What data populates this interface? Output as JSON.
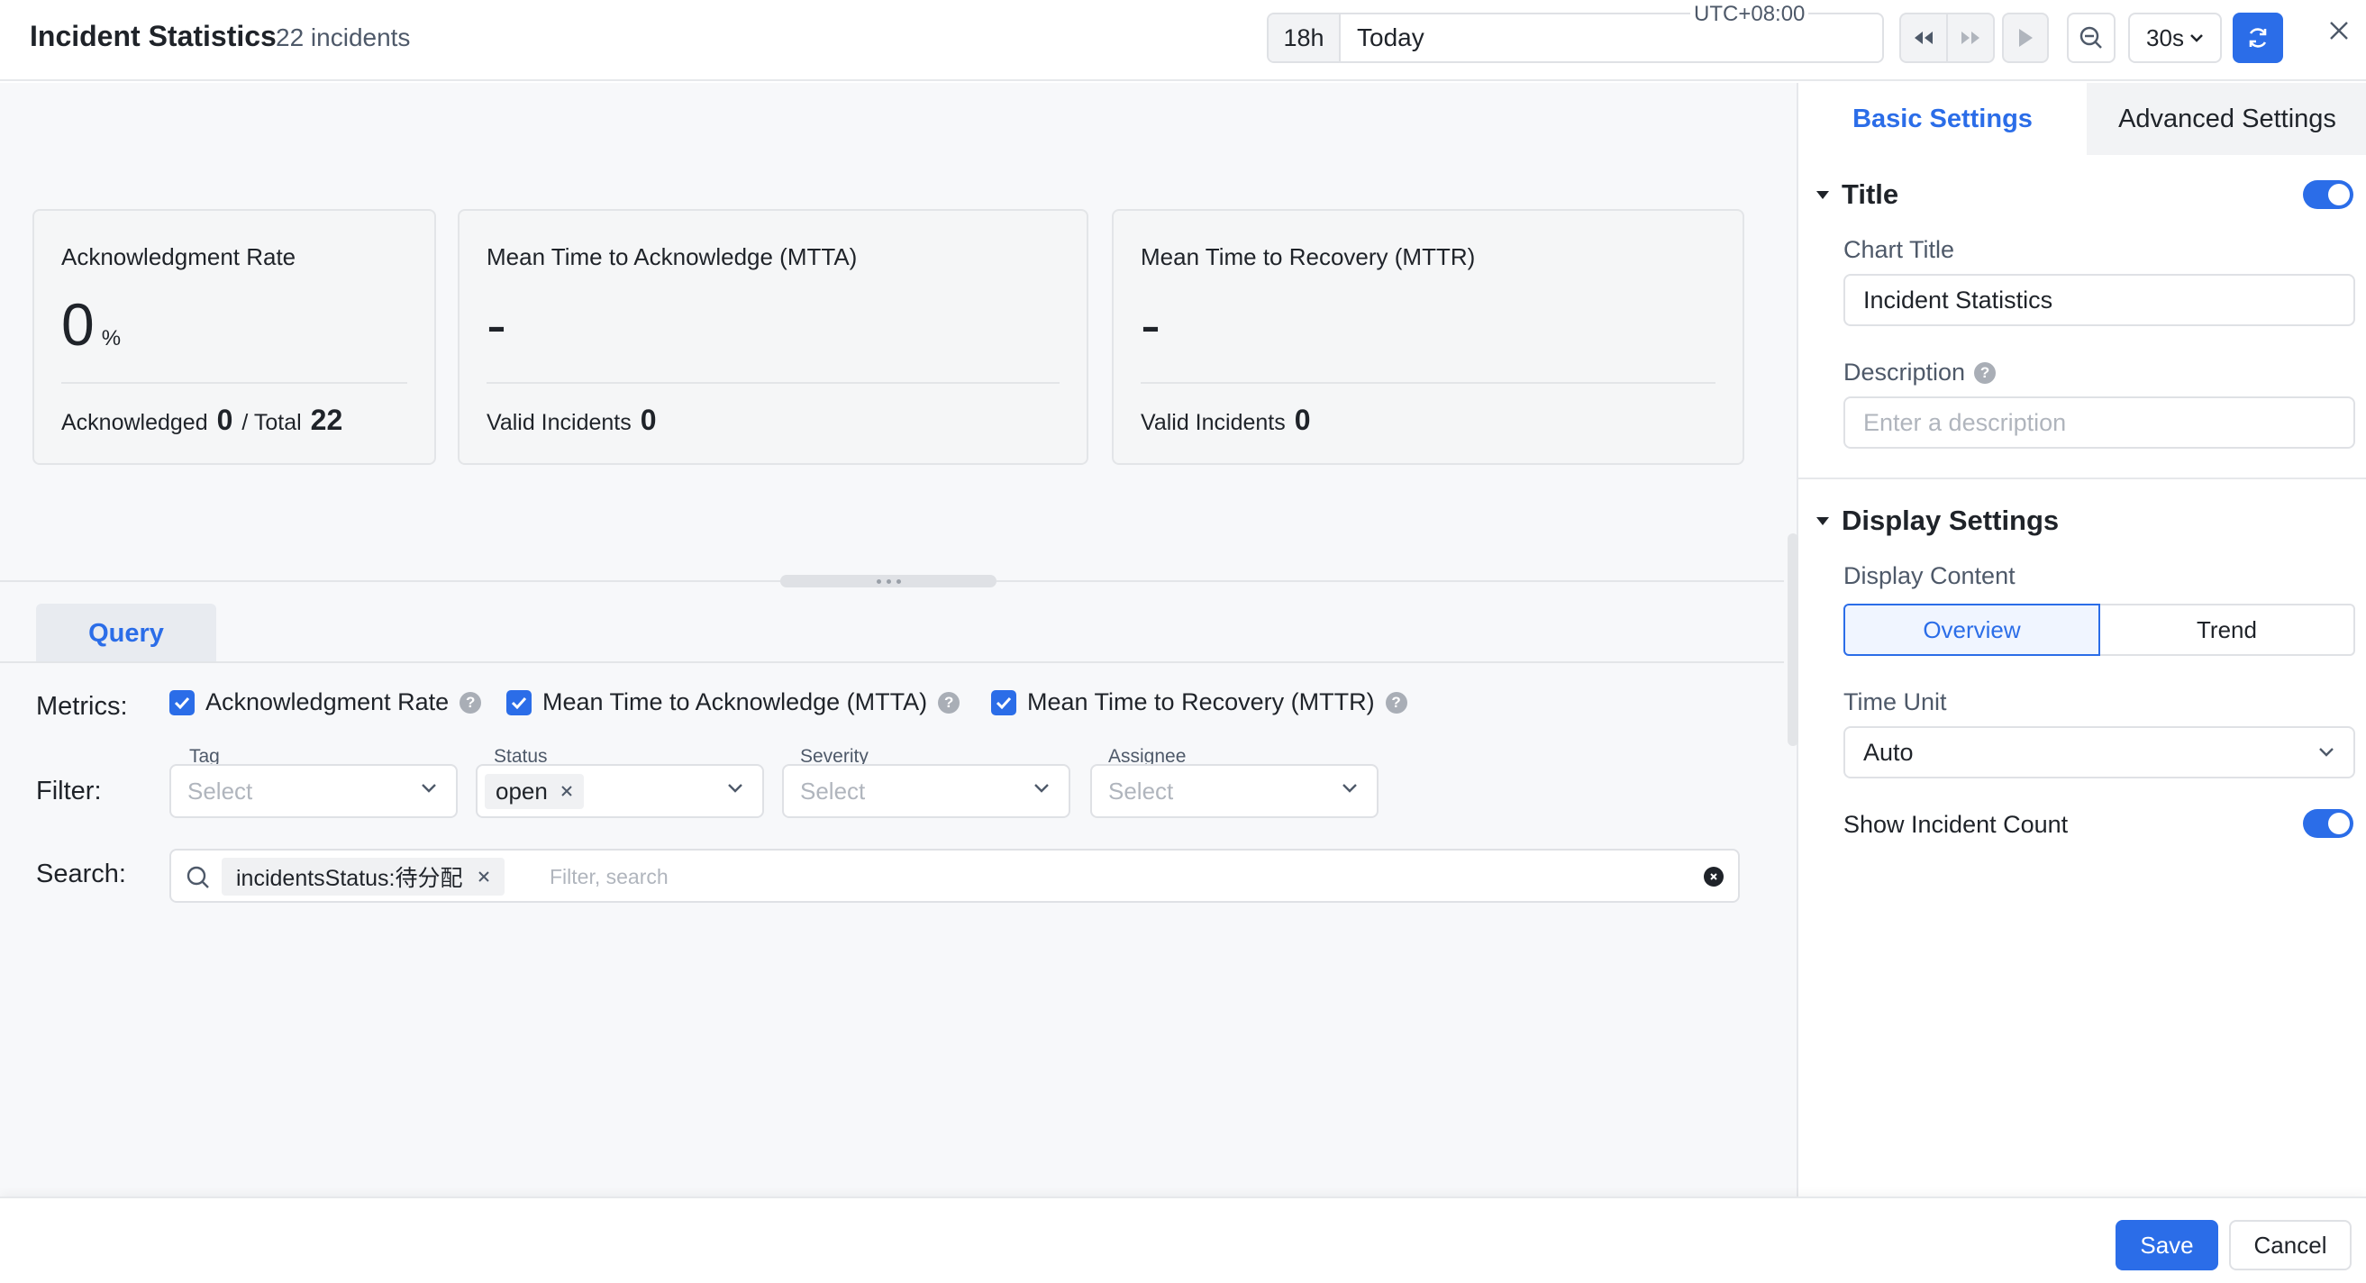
{
  "header": {
    "title": "Incident Statistics",
    "incident_count": "22 incidents",
    "timezone": "UTC+08:00",
    "quick_range": "18h",
    "range_text": "Today",
    "refresh_interval": "30s",
    "accent_color": "#2b6de8"
  },
  "cards": [
    {
      "title": "Acknowledgment Rate",
      "value": "0",
      "unit": "%",
      "foot_label_1": "Acknowledged",
      "foot_value_1": "0",
      "foot_label_2": "/ Total",
      "foot_value_2": "22"
    },
    {
      "title": "Mean Time to Acknowledge (MTTA)",
      "value": "-",
      "foot_label_1": "Valid Incidents",
      "foot_value_1": "0"
    },
    {
      "title": "Mean Time to Recovery (MTTR)",
      "value": "-",
      "foot_label_1": "Valid Incidents",
      "foot_value_1": "0"
    }
  ],
  "query": {
    "tab_label": "Query",
    "metrics_label": "Metrics:",
    "metrics": [
      {
        "label": "Acknowledgment Rate",
        "checked": true
      },
      {
        "label": "Mean Time to Acknowledge (MTTA)",
        "checked": true
      },
      {
        "label": "Mean Time to Recovery (MTTR)",
        "checked": true
      }
    ],
    "filter_label": "Filter:",
    "filters": [
      {
        "label": "Tag",
        "placeholder": "Select"
      },
      {
        "label": "Status",
        "selected": "open"
      },
      {
        "label": "Severity",
        "placeholder": "Select"
      },
      {
        "label": "Assignee",
        "placeholder": "Select"
      }
    ],
    "search_label": "Search:",
    "search_chip": "incidentsStatus:待分配",
    "search_placeholder": "Filter, search"
  },
  "settings": {
    "tabs": [
      "Basic Settings",
      "Advanced Settings"
    ],
    "title_section": "Title",
    "title_enabled": true,
    "chart_title_label": "Chart Title",
    "chart_title_value": "Incident Statistics",
    "description_label": "Description",
    "description_placeholder": "Enter a description",
    "display_section": "Display Settings",
    "display_content_label": "Display Content",
    "display_options": [
      "Overview",
      "Trend"
    ],
    "display_selected": "Overview",
    "time_unit_label": "Time Unit",
    "time_unit_value": "Auto",
    "show_count_label": "Show Incident Count",
    "show_count_enabled": true
  },
  "footer": {
    "save_label": "Save",
    "cancel_label": "Cancel"
  }
}
